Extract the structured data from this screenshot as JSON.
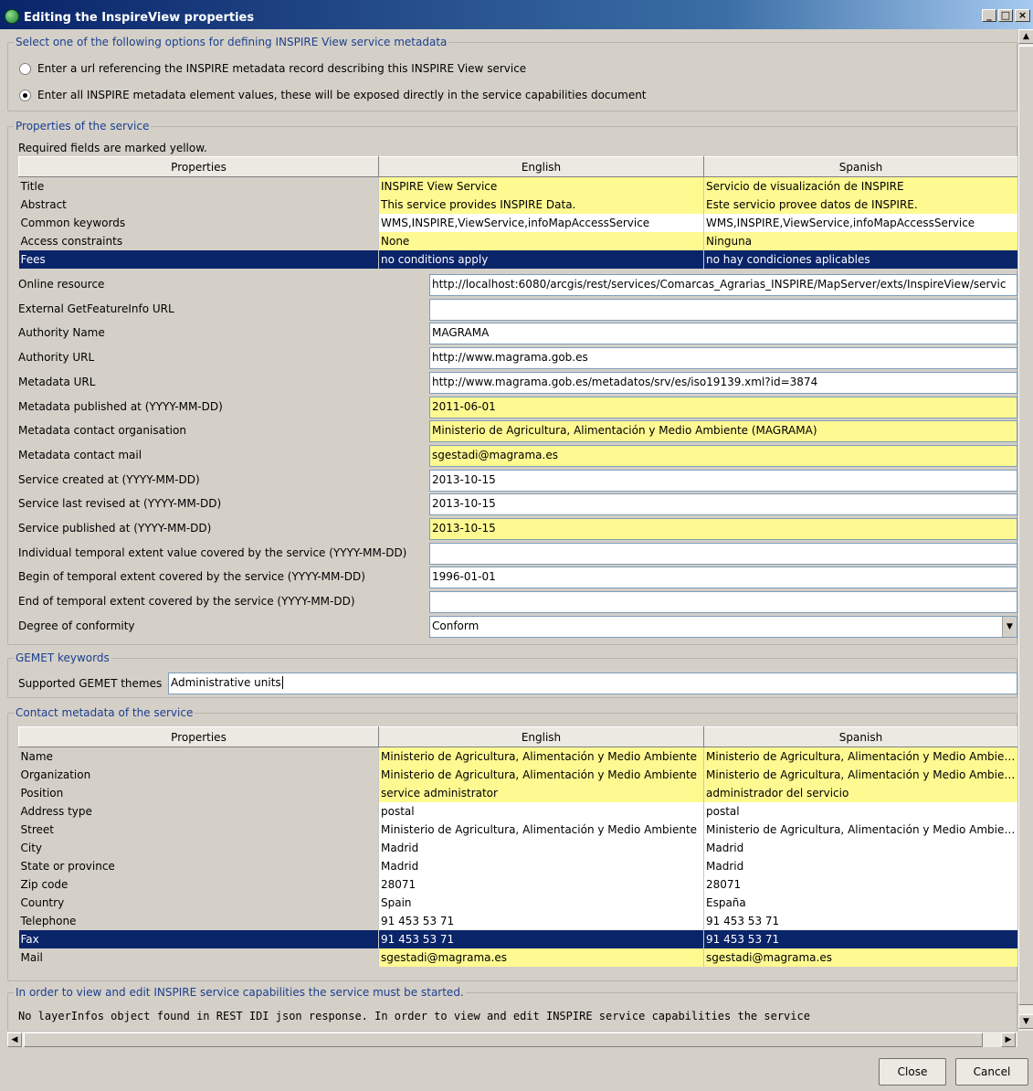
{
  "window": {
    "title": "Editing the InspireView properties"
  },
  "options": {
    "legend": "Select one of the following options for defining INSPIRE View service metadata",
    "radio1": "Enter a url referencing the INSPIRE metadata record describing this INSPIRE View service",
    "radio2": "Enter all INSPIRE metadata element values, these will be exposed directly in the service capabilities document",
    "selected": 2
  },
  "service": {
    "legend": "Properties of the service",
    "note": "Required fields are marked yellow.",
    "columns": [
      "Properties",
      "English",
      "Spanish"
    ],
    "rows": [
      {
        "prop": "Title",
        "en": "INSPIRE View Service",
        "es": "Servicio de visualización de INSPIRE",
        "required": true
      },
      {
        "prop": "Abstract",
        "en": "This service provides INSPIRE Data.",
        "es": "Este servicio provee datos de INSPIRE.",
        "required": true
      },
      {
        "prop": "Common keywords",
        "en": "WMS,INSPIRE,ViewService,infoMapAccessService",
        "es": "WMS,INSPIRE,ViewService,infoMapAccessService",
        "required": false
      },
      {
        "prop": "Access constraints",
        "en": "None",
        "es": "Ninguna",
        "required": true
      },
      {
        "prop": "Fees",
        "en": "no conditions apply",
        "es": "no hay condiciones aplicables",
        "required": true,
        "selected": true
      }
    ],
    "fields": [
      {
        "label": "Online resource",
        "value": "http://localhost:6080/arcgis/rest/services/Comarcas_Agrarias_INSPIRE/MapServer/exts/InspireView/servic",
        "required": false
      },
      {
        "label": "External GetFeatureInfo URL",
        "value": "",
        "required": false
      },
      {
        "label": "Authority Name",
        "value": "MAGRAMA",
        "required": false
      },
      {
        "label": "Authority URL",
        "value": "http://www.magrama.gob.es",
        "required": false
      },
      {
        "label": "Metadata URL",
        "value": "http://www.magrama.gob.es/metadatos/srv/es/iso19139.xml?id=3874",
        "required": false
      },
      {
        "label": "Metadata published at (YYYY-MM-DD)",
        "value": "2011-06-01",
        "required": true
      },
      {
        "label": "Metadata contact organisation",
        "value": "Ministerio de Agricultura, Alimentación y Medio Ambiente (MAGRAMA)",
        "required": true
      },
      {
        "label": "Metadata contact mail",
        "value": "sgestadi@magrama.es",
        "required": true
      },
      {
        "label": "Service created at (YYYY-MM-DD)",
        "value": "2013-10-15",
        "required": false
      },
      {
        "label": "Service last revised at (YYYY-MM-DD)",
        "value": "2013-10-15",
        "required": false
      },
      {
        "label": "Service published at (YYYY-MM-DD)",
        "value": "2013-10-15",
        "required": true
      },
      {
        "label": "Individual temporal extent value covered by the service (YYYY-MM-DD)",
        "value": "",
        "required": false
      },
      {
        "label": "Begin of temporal extent covered by the service (YYYY-MM-DD)",
        "value": "1996-01-01",
        "required": false
      },
      {
        "label": "End of temporal extent covered by the service (YYYY-MM-DD)",
        "value": "",
        "required": false
      }
    ],
    "conformity": {
      "label": "Degree of conformity",
      "value": "Conform"
    }
  },
  "gemet": {
    "legend": "GEMET keywords",
    "label": "Supported GEMET themes",
    "value": "Administrative units"
  },
  "contact": {
    "legend": "Contact metadata of the service",
    "columns": [
      "Properties",
      "English",
      "Spanish"
    ],
    "rows": [
      {
        "prop": "Name",
        "en": "Ministerio de Agricultura, Alimentación y Medio Ambiente",
        "es": "Ministerio de Agricultura, Alimentación y Medio Ambient.",
        "required": true
      },
      {
        "prop": "Organization",
        "en": "Ministerio de Agricultura, Alimentación y Medio Ambiente",
        "es": "Ministerio de Agricultura, Alimentación y Medio Ambient.",
        "required": true
      },
      {
        "prop": "Position",
        "en": "service administrator",
        "es": "administrador del servicio",
        "required": true
      },
      {
        "prop": "Address type",
        "en": "postal",
        "es": "postal",
        "required": false
      },
      {
        "prop": "Street",
        "en": "Ministerio de Agricultura, Alimentación y Medio Ambiente",
        "es": "Ministerio de Agricultura, Alimentación y Medio Ambient.",
        "required": false
      },
      {
        "prop": "City",
        "en": "Madrid",
        "es": "Madrid",
        "required": false
      },
      {
        "prop": "State or province",
        "en": "Madrid",
        "es": "Madrid",
        "required": false
      },
      {
        "prop": "Zip code",
        "en": "28071",
        "es": "28071",
        "required": false
      },
      {
        "prop": "Country",
        "en": "Spain",
        "es": "España",
        "required": false
      },
      {
        "prop": "Telephone",
        "en": "91 453 53 71",
        "es": "91 453 53 71",
        "required": false
      },
      {
        "prop": "Fax",
        "en": "91 453 53 71",
        "es": "91 453 53 71",
        "required": false,
        "selected": true
      },
      {
        "prop": "Mail",
        "en": "sgestadi@magrama.es",
        "es": "sgestadi@magrama.es",
        "required": true
      }
    ]
  },
  "capabilities": {
    "legend": "In order to view and edit INSPIRE service capabilities the service must be started.",
    "message": "No layerInfos object found in REST IDI json response. In order to view and edit INSPIRE service capabilities the service"
  },
  "buttons": {
    "close": "Close",
    "cancel": "Cancel"
  }
}
